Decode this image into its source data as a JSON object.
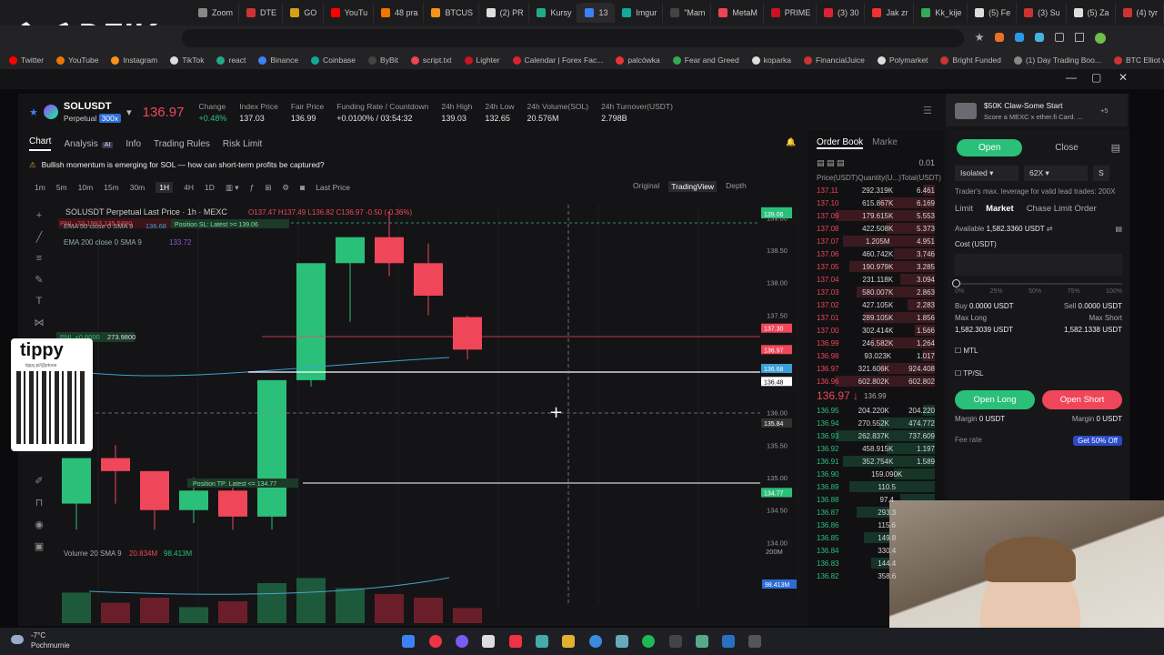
{
  "browser": {
    "tabs": [
      "Zoom",
      "DTE",
      "GO",
      "YouTu",
      "48 pra",
      "BTCUS",
      "(2) PR",
      "Kursy",
      "13",
      "Imgur",
      "\"Mam",
      "MetaM",
      "PRIME",
      "(3) 30",
      "Jak zr",
      "Kk_kije",
      "(5) Fe",
      "(3) Su",
      "(5) Za",
      "(4) tyr"
    ],
    "active_tab": 8,
    "bookmarks": [
      "Twitter",
      "YouTube",
      "Instagram",
      "TikTok",
      "react",
      "Binance",
      "Coinbase",
      "ByBit",
      "script.txt",
      "Lighter",
      "Calendar | Forex Fac...",
      "palcówka",
      "Fear and Greed",
      "koparka",
      "FinancialJuice",
      "Polymarket",
      "Bright Funded",
      "(1) Day Trading Boo...",
      "BTC Elliot wave"
    ],
    "logo": "DZIK"
  },
  "header": {
    "symbol": "SOLUSDT",
    "market": "Perpetual",
    "leverage_badge": "300x",
    "price": "136.97",
    "stats": [
      {
        "label": "Change",
        "value": "+0.48%",
        "color": "green"
      },
      {
        "label": "Index Price",
        "value": "137.03"
      },
      {
        "label": "Fair Price",
        "value": "136.99"
      },
      {
        "label": "Funding Rate / Countdown",
        "value": "+0.0100% / 03:54:32"
      },
      {
        "label": "24h High",
        "value": "139.03"
      },
      {
        "label": "24h Low",
        "value": "132.65"
      },
      {
        "label": "24h Volume(SOL)",
        "value": "20.576M"
      },
      {
        "label": "24h Turnover(USDT)",
        "value": "2.798B"
      }
    ]
  },
  "nav_tabs": [
    "Chart",
    "Analysis",
    "Info",
    "Trading Rules",
    "Risk Limit"
  ],
  "ai_badge": "AI",
  "banner": "Bullish momentum is emerging for SOL — how can short-term profits be captured?",
  "intervals": [
    "1m",
    "5m",
    "10m",
    "15m",
    "30m",
    "1H",
    "4H",
    "1D"
  ],
  "active_interval": "1H",
  "last_price_label": "Last Price",
  "view_modes": [
    "Original",
    "TradingView",
    "Depth"
  ],
  "chart_legend": {
    "title": "SOLUSDT Perpetual Last Price · 1h · MEXC",
    "ohlc": "O137.47 H137.49 L136.82 C136.97 -0.50 (-0.36%)",
    "pnl_tag": "PNL -23.1993  135.5890",
    "sl_tag": "Position SL: Latest >= 139.06",
    "all": "All",
    "ema50": "EMA 50 close 0 SMA 9",
    "ema50_val": "136.68",
    "ema200": "EMA 200 close 0 SMA 9",
    "ema200_val": "133.72",
    "pnl2": "PNL +0.6000",
    "pnl2_price": "273.9800",
    "tp_tag": "Position TP: Latest <= 134.77",
    "volume": "Volume 20 SMA 9",
    "vol_a": "20.834M",
    "vol_b": "98.413M",
    "vol_axis": "200M",
    "vol_last": "98.413M"
  },
  "price_axis": [
    {
      "p": "139.00"
    },
    {
      "p": "138.50"
    },
    {
      "p": "138.00"
    },
    {
      "p": "137.50"
    },
    {
      "p": "137.00"
    },
    {
      "p": "136.50"
    },
    {
      "p": "136.00"
    },
    {
      "p": "135.50"
    },
    {
      "p": "135.00"
    },
    {
      "p": "134.50"
    },
    {
      "p": "134.00"
    }
  ],
  "axis_tags": [
    {
      "v": "139.09",
      "c": "#2bc07a"
    },
    {
      "v": "139.06",
      "c": "#2bc07a"
    },
    {
      "v": "137.30",
      "c": "#f0465a"
    },
    {
      "v": "136.97",
      "c": "#f0465a"
    },
    {
      "v": "136.68",
      "c": "#3aa0d8"
    },
    {
      "v": "136.48",
      "c": "#ffffff"
    },
    {
      "v": "135.84",
      "c": "#333"
    },
    {
      "v": "134.77",
      "c": "#ffffff"
    },
    {
      "v": "134.77",
      "c": "#2bc07a"
    }
  ],
  "chart_data": {
    "type": "candlestick",
    "interval": "1H",
    "ylim": [
      133.6,
      139.2
    ],
    "candles": [
      {
        "o": 134.6,
        "h": 135.1,
        "l": 134.2,
        "c": 135.3
      },
      {
        "o": 135.3,
        "h": 135.5,
        "l": 134.6,
        "c": 135.1
      },
      {
        "o": 135.1,
        "h": 135.1,
        "l": 134.2,
        "c": 134.5
      },
      {
        "o": 134.5,
        "h": 135.0,
        "l": 134.3,
        "c": 134.8
      },
      {
        "o": 134.8,
        "h": 134.9,
        "l": 134.2,
        "c": 134.4
      },
      {
        "o": 134.4,
        "h": 136.5,
        "l": 134.2,
        "c": 136.5
      },
      {
        "o": 136.5,
        "h": 138.3,
        "l": 136.4,
        "c": 138.3
      },
      {
        "o": 138.3,
        "h": 138.7,
        "l": 137.4,
        "c": 138.7
      },
      {
        "o": 138.7,
        "h": 139.1,
        "l": 138.1,
        "c": 138.3
      },
      {
        "o": 138.3,
        "h": 138.6,
        "l": 137.5,
        "c": 137.8
      },
      {
        "o": 137.47,
        "h": 137.49,
        "l": 136.82,
        "c": 136.97
      }
    ],
    "volumes": [
      42,
      28,
      35,
      22,
      30,
      55,
      62,
      48,
      40,
      35,
      20.834
    ]
  },
  "orderbook": {
    "tabs": [
      "Order Book",
      "Marke"
    ],
    "tick": "0.01",
    "cols": [
      "Price(USDT)",
      "Quantity(U...)",
      "Total(USDT)"
    ],
    "asks": [
      [
        "137.11",
        "292.319K",
        "6.461"
      ],
      [
        "137.10",
        "615.867K",
        "6.169"
      ],
      [
        "137.09",
        "179.615K",
        "5.553"
      ],
      [
        "137.08",
        "422.508K",
        "5.373"
      ],
      [
        "137.07",
        "1.205M",
        "4.951"
      ],
      [
        "137.06",
        "460.742K",
        "3.746"
      ],
      [
        "137.05",
        "190.979K",
        "3.285"
      ],
      [
        "137.04",
        "231.118K",
        "3.094"
      ],
      [
        "137.03",
        "580.007K",
        "2.863"
      ],
      [
        "137.02",
        "427.105K",
        "2.283"
      ],
      [
        "137.01",
        "289.105K",
        "1.856"
      ],
      [
        "137.00",
        "302.414K",
        "1.566"
      ],
      [
        "136.99",
        "246.582K",
        "1.264"
      ],
      [
        "136.98",
        "93.023K",
        "1.017"
      ],
      [
        "136.97",
        "321.606K",
        "924.408"
      ],
      [
        "136.96",
        "602.802K",
        "602.802"
      ]
    ],
    "last": "136.97",
    "last_arrow": "↓",
    "mark": "136.99",
    "bids": [
      [
        "136.95",
        "204.220K",
        "204.220"
      ],
      [
        "136.94",
        "270.552K",
        "474.772"
      ],
      [
        "136.93",
        "262.837K",
        "737.609"
      ],
      [
        "136.92",
        "458.915K",
        "1.197"
      ],
      [
        "136.91",
        "352.754K",
        "1.589"
      ],
      [
        "136.90",
        "159.090K",
        ""
      ],
      [
        "136.89",
        "110.5",
        ""
      ],
      [
        "136.88",
        "97.4",
        ""
      ],
      [
        "136.87",
        "293.3",
        ""
      ],
      [
        "136.86",
        "115.6",
        ""
      ],
      [
        "136.85",
        "149.8",
        ""
      ],
      [
        "136.84",
        "330.4",
        ""
      ],
      [
        "136.83",
        "144.4",
        ""
      ],
      [
        "136.82",
        "358.6",
        ""
      ]
    ]
  },
  "trade": {
    "promo_title": "$50K Claw-Some Start",
    "promo_sub": "Score a MEXC x ether.fi Card. ...",
    "promo_badge": "+5",
    "open": "Open",
    "close": "Close",
    "margin_mode": "Isolated",
    "leverage": "62X",
    "s_btn": "S",
    "hint": "Trader's max. leverage for valid lead trades: 200X",
    "order_types": [
      "Limit",
      "Market",
      "Chase Limit Order"
    ],
    "available_label": "Available",
    "available": "1,582.3360 USDT",
    "cost_label": "Cost (USDT)",
    "pct": [
      "0%",
      "25%",
      "50%",
      "75%",
      "100%"
    ],
    "buy_label": "Buy",
    "buy_val": "0.0000 USDT",
    "sell_label": "Sell",
    "sell_val": "0.0000 USDT",
    "max_long": "Max Long",
    "max_long_val": "1,582.3039 USDT",
    "max_short": "Max Short",
    "max_short_val": "1,582.1338 USDT",
    "mtl": "MTL",
    "tpsl": "TP/SL",
    "open_long": "Open Long",
    "open_short": "Open Short",
    "margin_l": "Margin",
    "margin_l_val": "0 USDT",
    "margin_r": "Margin",
    "margin_r_val": "0 USDT",
    "fee_rate": "Fee rate",
    "get_off": "Get 50% Off"
  },
  "overlay": {
    "tippy": "tippy",
    "tippy_url": "tippy.pl/@ptone"
  },
  "weather": {
    "temp": "-7°C",
    "desc": "Pochmurnie"
  }
}
